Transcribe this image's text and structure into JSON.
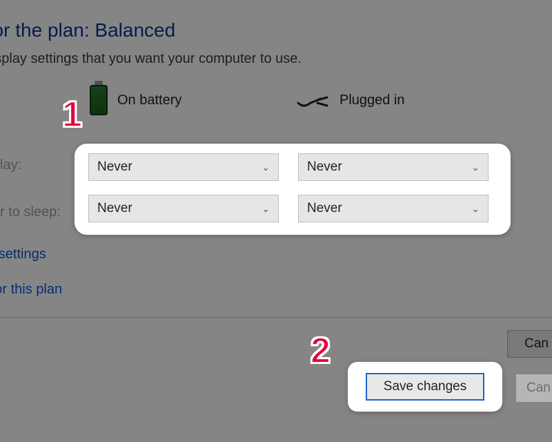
{
  "title": "s for the plan: Balanced",
  "subtitle": "d display settings that you want your computer to use.",
  "columns": {
    "battery": "On battery",
    "plugged": "Plugged in"
  },
  "rows": {
    "display": {
      "label": "lay:",
      "battery_value": "Never",
      "plugged_value": "Never"
    },
    "sleep": {
      "label": "r to sleep:",
      "battery_value": "Never",
      "plugged_value": "Never"
    }
  },
  "links": {
    "advanced": "wer settings",
    "restore": "gs for this plan"
  },
  "buttons": {
    "save": "Save changes",
    "cancel": "Can"
  },
  "callouts": {
    "one": "1",
    "two": "2"
  }
}
